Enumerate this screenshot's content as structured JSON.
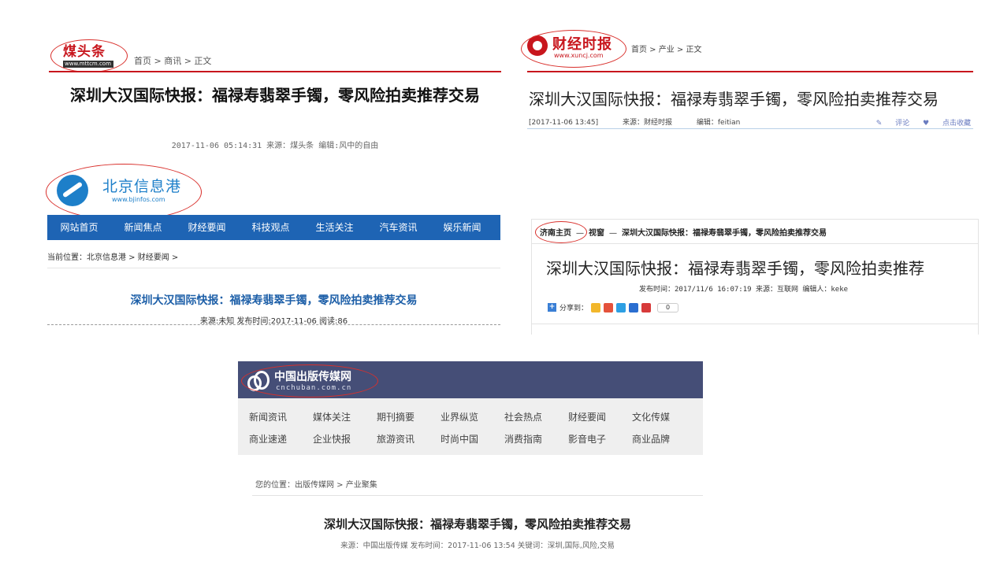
{
  "panel1": {
    "logo_text": "煤头条",
    "logo_url": "www.mttcm.com",
    "breadcrumb": "首页 > 商讯 > 正文",
    "title": "深圳大汉国际快报：福禄寿翡翠手镯，零风险拍卖推荐交易",
    "meta": "2017-11-06 05:14:31  来源：煤头条  编辑:风中的自由",
    "accent_color": "#c8161d"
  },
  "panel2": {
    "logo_text": "财经时报",
    "logo_url": "www.xuncj.com",
    "breadcrumb": "首页 > 产业 > 正文",
    "title": "深圳大汉国际快报：福禄寿翡翠手镯，零风险拍卖推荐交易",
    "date": "[2017-11-06 13:45]",
    "source": "来源：财经时报",
    "editor": "编辑：feitian",
    "comment_label": "评论",
    "favorite_label": "点击收藏",
    "accent_color": "#c8161d"
  },
  "panel3": {
    "logo_text": "北京信息港",
    "logo_url": "www.bjinfos.com",
    "nav": [
      "网站首页",
      "新闻焦点",
      "财经要闻",
      "科技观点",
      "生活关注",
      "汽车资讯",
      "娱乐新闻"
    ],
    "breadcrumb": "当前位置：北京信息港 > 财经要闻 >",
    "title": "深圳大汉国际快报：福禄寿翡翠手镯，零风险拍卖推荐交易",
    "meta": "来源:未知 发布时间:2017-11-06 阅读:86",
    "nav_color": "#1e64b4"
  },
  "panel4": {
    "home": "济南主页",
    "crumb_sep": "—",
    "section": "视窗",
    "crumb_title": "深圳大汉国际快报：福禄寿翡翠手镯，零风险拍卖推荐交易",
    "title": "深圳大汉国际快报：福禄寿翡翠手镯，零风险拍卖推荐",
    "meta": "发布时间：2017/11/6 16:07:19 来源：互联网 编辑人：keke",
    "share_label": "分享到：",
    "share_count": "0"
  },
  "panel5": {
    "logo_text": "中国出版传媒网",
    "logo_url": "cnchuban.com.cn",
    "menu_row1": [
      "新闻资讯",
      "媒体关注",
      "期刊摘要",
      "业界纵览",
      "社会热点",
      "财经要闻",
      "文化传媒"
    ],
    "menu_row2": [
      "商业速递",
      "企业快报",
      "旅游资讯",
      "时尚中国",
      "消费指南",
      "影音电子",
      "商业品牌"
    ],
    "breadcrumb": "您的位置：出版传媒网 > 产业聚集",
    "title": "深圳大汉国际快报：福禄寿翡翠手镯，零风险拍卖推荐交易",
    "meta": "来源：中国出版传媒   发布时间：2017-11-06 13:54   关键词：深圳,国际,风险,交易",
    "header_color": "#454e77"
  }
}
